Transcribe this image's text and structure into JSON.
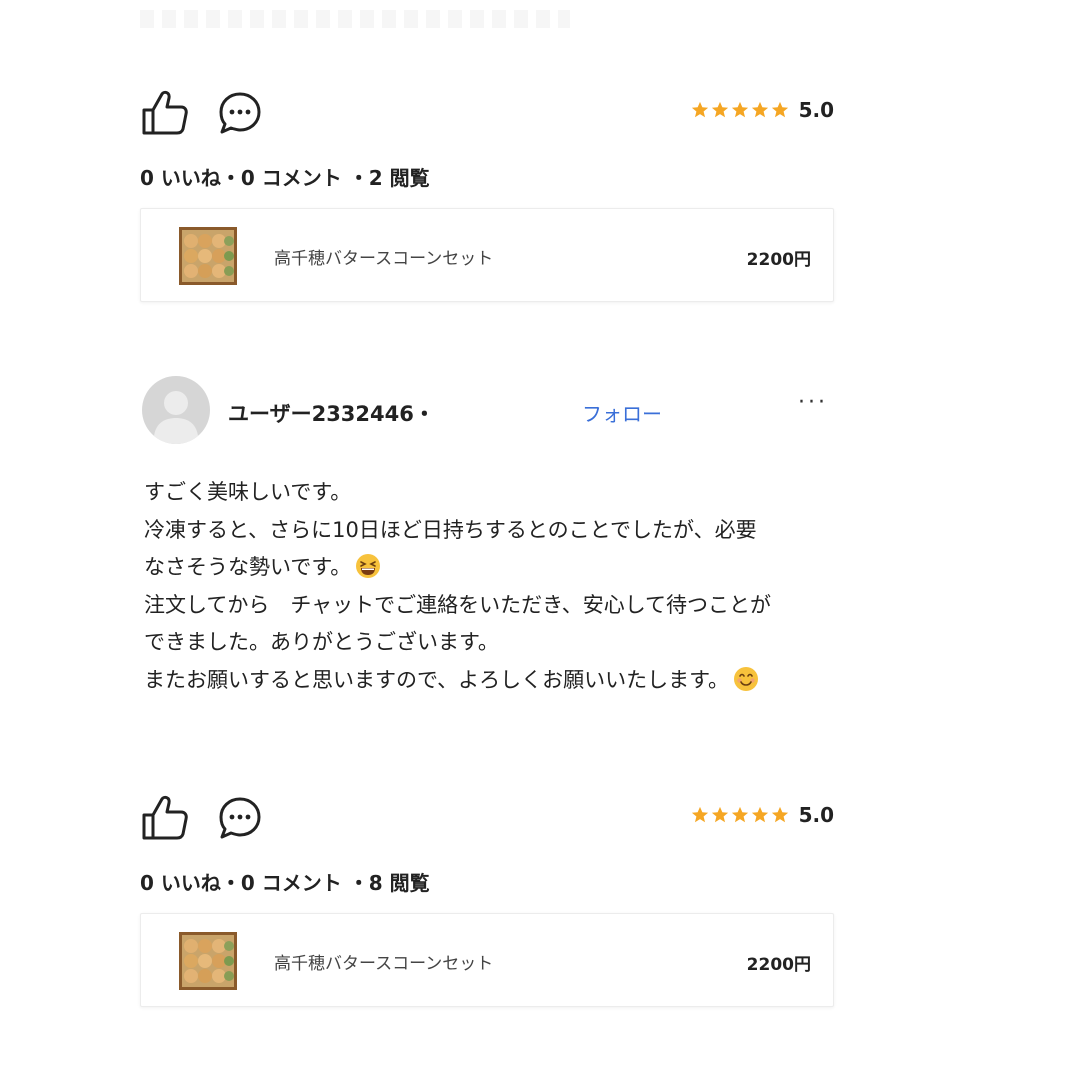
{
  "reviews": [
    {
      "rating": "5.0",
      "stars": 5,
      "stats": "0 いいね・0 コメント ・2 閲覧",
      "product": {
        "name": "高千穂バタースコーンセット",
        "price": "2200円"
      }
    },
    {
      "rating": "5.0",
      "stars": 5,
      "stats": "0 いいね・0 コメント ・8 閲覧",
      "product": {
        "name": "高千穂バタースコーンセット",
        "price": "2200円"
      }
    }
  ],
  "user": {
    "name": "ユーザー2332446・",
    "follow_label": "フォロー",
    "more_label": "···"
  },
  "review_text": {
    "line1": "すごく美味しいです。",
    "line2": "冷凍すると、さらに10日ほど日持ちするとのことでしたが、必要",
    "line3": "なさそうな勢いです。",
    "line4": "注文してから　チャットでご連絡をいただき、安心して待つことが",
    "line5": "できました。ありがとうございます。",
    "line6": "またお願いすると思いますので、よろしくお願いいたします。"
  },
  "colors": {
    "star": "#f5a623",
    "link": "#3a6fd8",
    "text": "#222222"
  },
  "icons": [
    "thumbs-up-icon",
    "comment-icon",
    "star-icon",
    "avatar-placeholder-icon",
    "more-icon"
  ]
}
